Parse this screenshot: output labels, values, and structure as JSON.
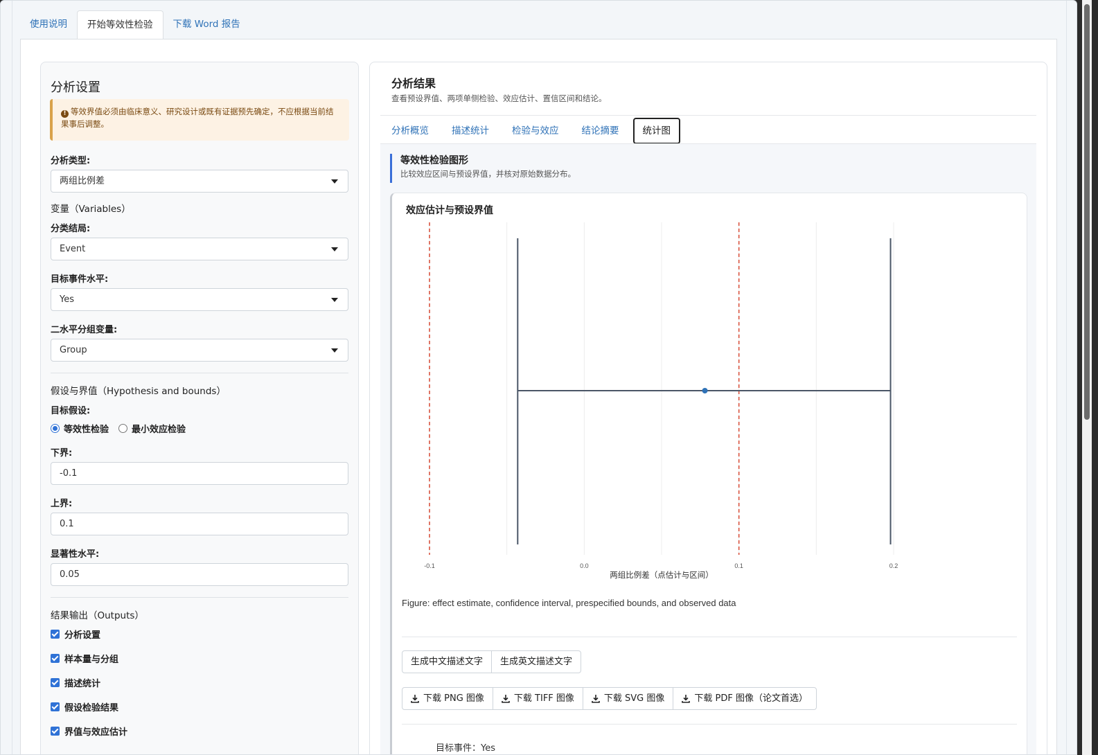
{
  "tabs": [
    "使用说明",
    "开始等效性检验",
    "下载 Word 报告"
  ],
  "settings": {
    "title": "分析设置",
    "alert": "等效界值必须由临床意义、研究设计或既有证据预先确定，不应根据当前结果事后调整。",
    "analysis_type_label": "分析类型:",
    "analysis_type_value": "两组比例差",
    "variables_label": "变量（Variables）",
    "outcome_label": "分类结局:",
    "outcome_value": "Event",
    "event_level_label": "目标事件水平:",
    "event_level_value": "Yes",
    "group_label": "二水平分组变量:",
    "group_value": "Group",
    "hypothesis_label": "假设与界值（Hypothesis and bounds）",
    "target_label": "目标假设:",
    "radio_equivalence": "等效性检验",
    "radio_minimal": "最小效应检验",
    "lower_label": "下界:",
    "lower_value": "-0.1",
    "upper_label": "上界:",
    "upper_value": "0.1",
    "alpha_label": "显著性水平:",
    "alpha_value": "0.05",
    "outputs_label": "结果输出（Outputs）",
    "outputs": [
      "分析设置",
      "样本量与分组",
      "描述统计",
      "假设检验结果",
      "界值与效应估计"
    ]
  },
  "results": {
    "title": "分析结果",
    "subtitle": "查看预设界值、两项单侧检验、效应估计、置信区间和结论。",
    "subtabs": [
      "分析概览",
      "描述统计",
      "检验与效应",
      "结论摘要",
      "统计图"
    ],
    "section_title": "等效性检验图形",
    "section_subtitle": "比较效应区间与预设界值，并核对原始数据分布。",
    "figure_caption": "Figure: effect estimate, confidence interval, prespecified bounds, and observed data",
    "text_buttons": [
      "生成中文描述文字",
      "生成英文描述文字"
    ],
    "download_buttons": [
      "下载 PNG 图像",
      "下载 TIFF 图像",
      "下载 SVG 图像",
      "下载 PDF 图像（论文首选）"
    ],
    "target_event": "目标事件：Yes"
  },
  "chart_data": {
    "type": "scatter",
    "title": "效应估计与预设界值",
    "xlabel": "两组比例差（点估计与区间）",
    "ylabel": "",
    "xlim": [
      -0.1,
      0.2
    ],
    "x_ticks": [
      "-0.1",
      "0.0",
      "0.1",
      "0.2"
    ],
    "point_estimate": 0.078,
    "ci": [
      -0.043,
      0.198
    ],
    "bounds": [
      -0.1,
      0.1
    ],
    "colors": {
      "interval": "#4a5667",
      "point": "#2f72b7",
      "bounds": "#d9533f"
    }
  }
}
